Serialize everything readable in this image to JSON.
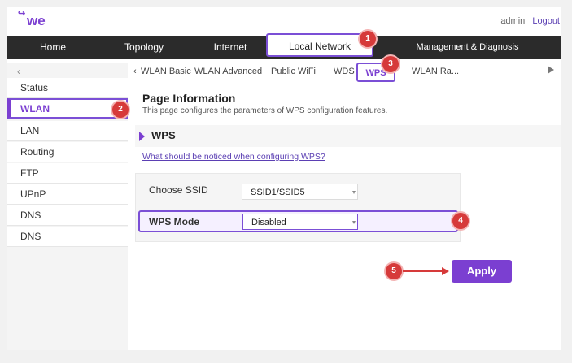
{
  "header": {
    "logo_text": "we",
    "user": "admin",
    "logout": "Logout"
  },
  "mainnav": {
    "items": [
      "Home",
      "Topology",
      "Internet",
      "Local Network",
      "Management & Diagnosis"
    ],
    "active": "Local Network"
  },
  "subnav": {
    "tabs": [
      "WLAN Basic",
      "WLAN Advanced",
      "Public WiFi",
      "WDS",
      "WPS",
      "WLAN Ra..."
    ],
    "active": "WPS",
    "left_arrow": "‹"
  },
  "sidebar": {
    "collapse": "‹",
    "items": [
      "Status",
      "WLAN",
      "LAN",
      "Routing",
      "FTP",
      "UPnP",
      "DNS",
      "DNS"
    ],
    "active": "WLAN"
  },
  "page": {
    "title": "Page Information",
    "description": "This page configures the parameters of WPS configuration features.",
    "section": "WPS",
    "help_link": "What should be noticed when configuring WPS?"
  },
  "form": {
    "ssid_label": "Choose SSID",
    "ssid_value": "SSID1/SSID5",
    "wps_label": "WPS Mode",
    "wps_value": "Disabled"
  },
  "actions": {
    "apply": "Apply"
  },
  "annotations": [
    "1",
    "2",
    "3",
    "4",
    "5"
  ],
  "colors": {
    "accent": "#7b3fd1",
    "badge": "#d63a3a",
    "nav_bg": "#2b2b2b"
  }
}
